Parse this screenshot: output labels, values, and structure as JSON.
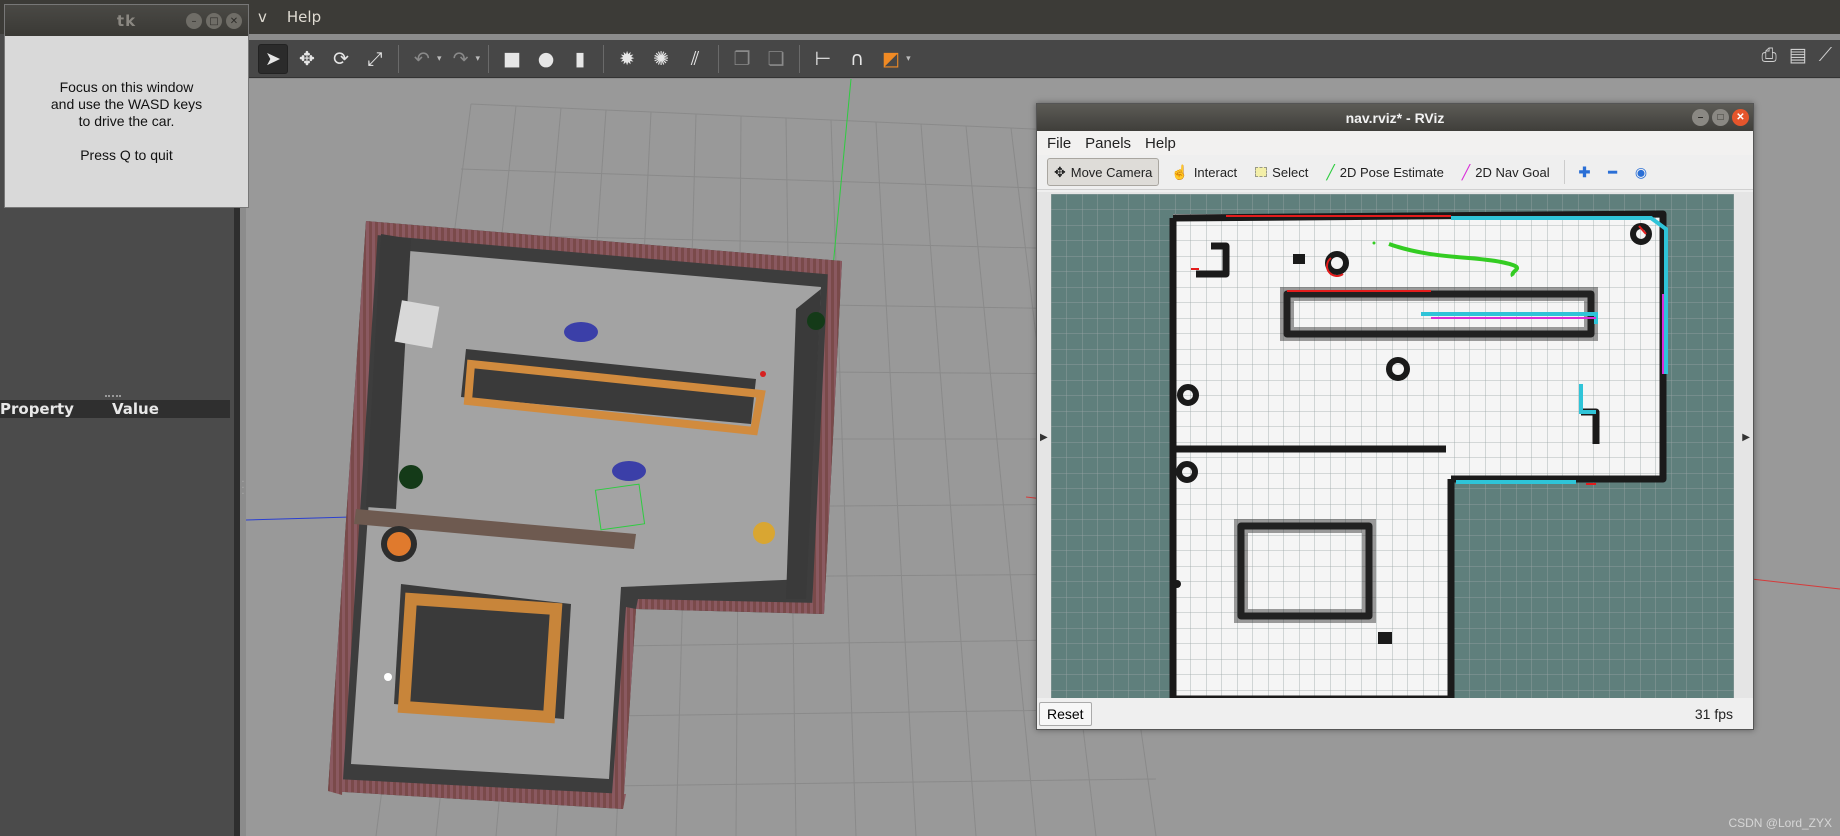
{
  "gazebo": {
    "menu": [
      "v",
      "Help"
    ],
    "property_panel": {
      "col_property": "Property",
      "col_value": "Value"
    }
  },
  "tk_window": {
    "title": "tk",
    "lines": [
      "Focus on this window",
      "and use the WASD keys",
      "to drive the car."
    ],
    "quit_line": "Press Q to quit"
  },
  "rviz": {
    "title": "nav.rviz* - RViz",
    "menu": [
      "File",
      "Panels",
      "Help"
    ],
    "tools": [
      {
        "label": "Move Camera",
        "icon": "move-camera-icon"
      },
      {
        "label": "Interact",
        "icon": "hand-pointer-icon"
      },
      {
        "label": "Select",
        "icon": "select-box-icon"
      },
      {
        "label": "2D Pose Estimate",
        "icon": "green-arrow-icon"
      },
      {
        "label": "2D Nav Goal",
        "icon": "magenta-arrow-icon"
      }
    ],
    "reset_label": "Reset",
    "fps": "31 fps"
  },
  "watermark": "CSDN @Lord_ZYX",
  "colors": {
    "gazebo_bg": "#999999",
    "map_free": "#f5f5f5",
    "map_unknown": "#5f7f7c",
    "obstacle": "#1a1a1a",
    "laser": "#e31c1c",
    "costmap": "#2fc4d8",
    "path": "#33cc22",
    "active_tool": "#dedcd8"
  }
}
